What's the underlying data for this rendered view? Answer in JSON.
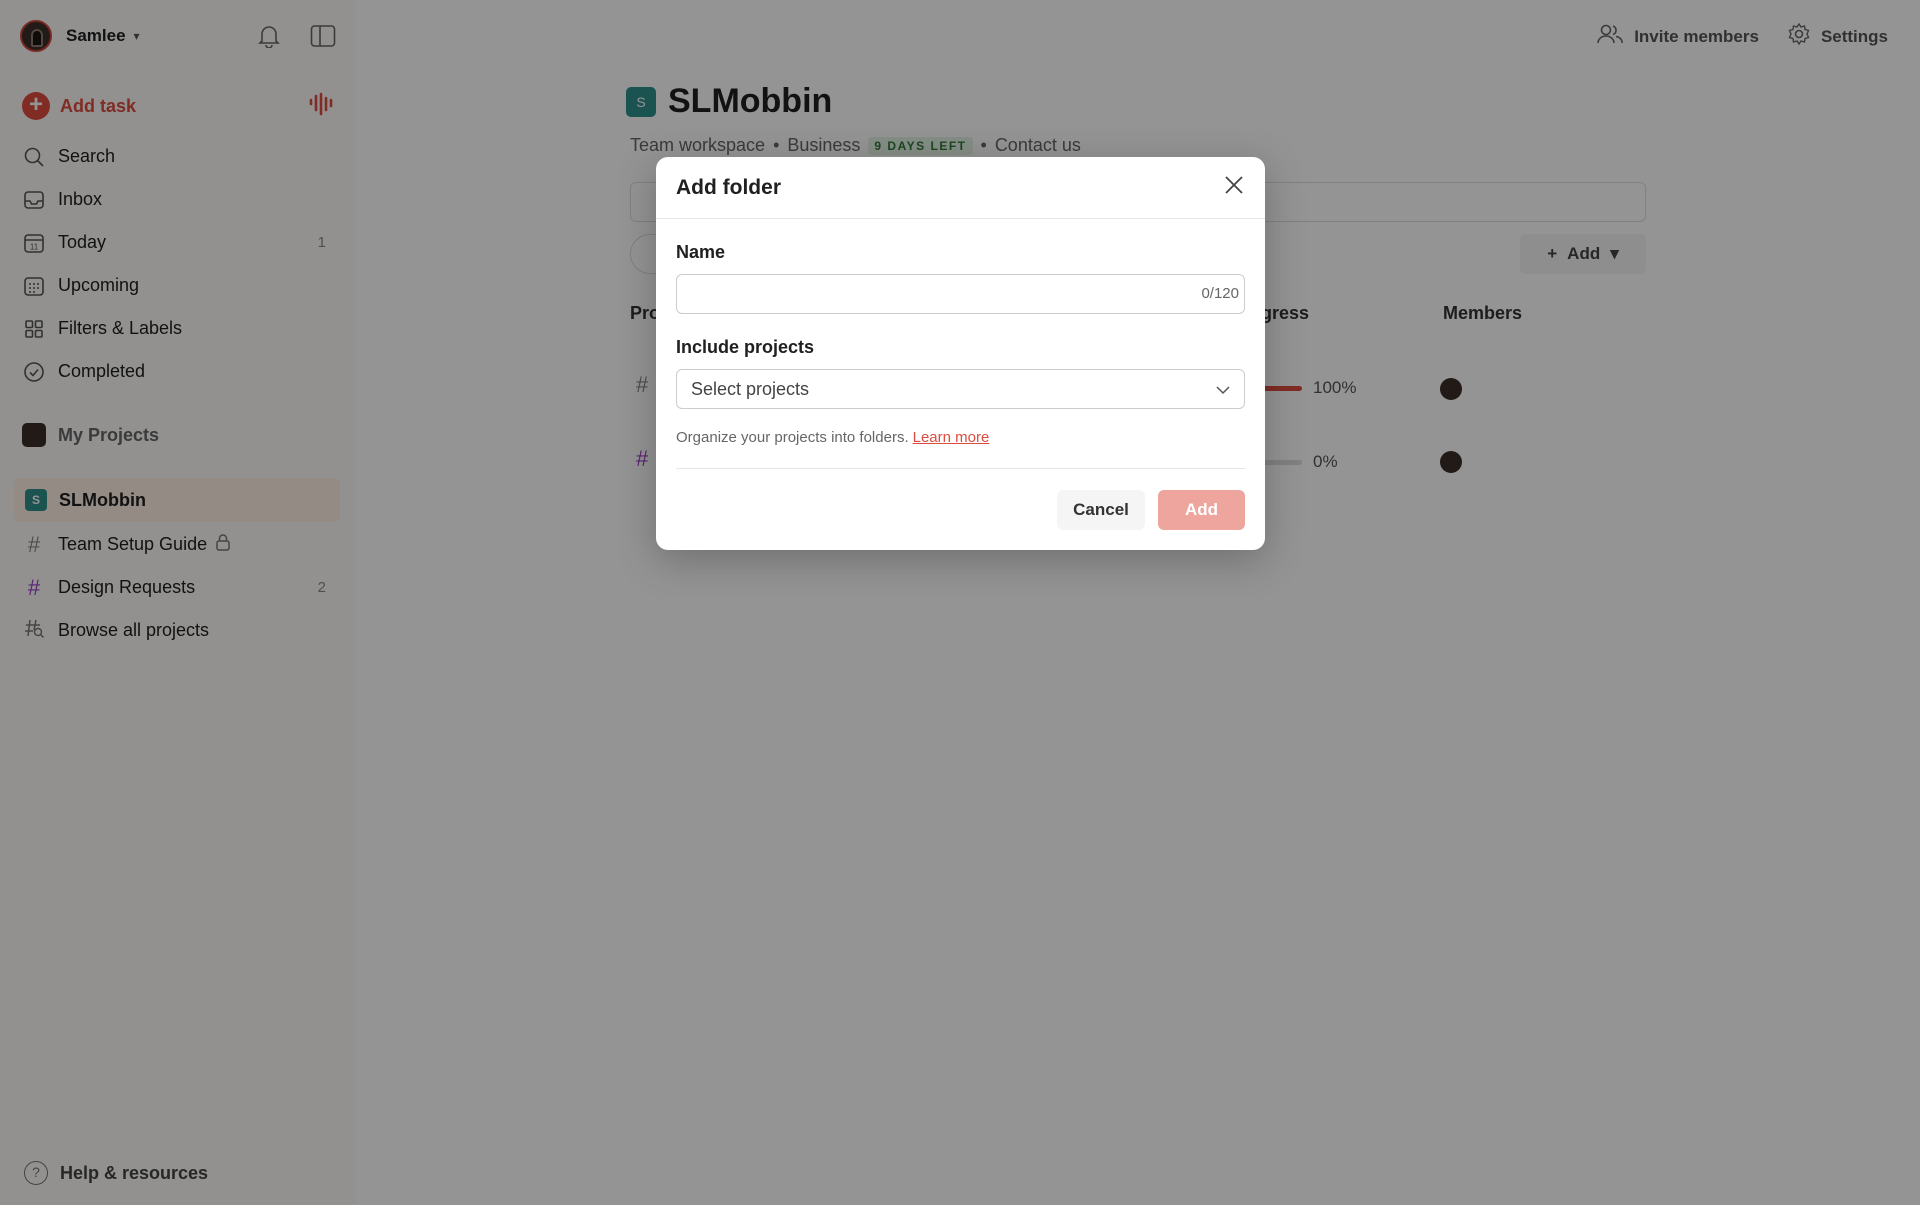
{
  "sidebar": {
    "user_name": "Samlee",
    "add_task_label": "Add task",
    "nav": [
      {
        "label": "Search",
        "icon": "search-icon",
        "count": ""
      },
      {
        "label": "Inbox",
        "icon": "inbox-icon",
        "count": ""
      },
      {
        "label": "Today",
        "icon": "calendar-today-icon",
        "count": "1"
      },
      {
        "label": "Upcoming",
        "icon": "calendar-grid-icon",
        "count": ""
      },
      {
        "label": "Filters & Labels",
        "icon": "grid-icon",
        "count": ""
      },
      {
        "label": "Completed",
        "icon": "check-circle-icon",
        "count": ""
      }
    ],
    "my_projects_label": "My Projects",
    "workspace": {
      "badge": "S",
      "name": "SLMobbin"
    },
    "projects": [
      {
        "label": "Team Setup Guide",
        "count": ""
      },
      {
        "label": "Design Requests",
        "count": "2"
      },
      {
        "label": "Browse all projects",
        "count": ""
      }
    ],
    "help_label": "Help & resources"
  },
  "topbar": {
    "invite_label": "Invite members",
    "settings_label": "Settings"
  },
  "main": {
    "badge": "S",
    "title": "SLMobbin",
    "meta_workspace": "Team workspace",
    "meta_plan": "Business",
    "meta_days_left": "9 DAYS LEFT",
    "meta_contact": "Contact us",
    "add_button_label": "Add",
    "col_project": "Pro",
    "col_progress": "ogress",
    "col_members": "Members",
    "rows": [
      {
        "progress_percent": 100,
        "progress_label": "100%"
      },
      {
        "progress_percent": 0,
        "progress_label": "0%"
      }
    ]
  },
  "modal": {
    "title": "Add folder",
    "name_label": "Name",
    "name_value": "",
    "name_counter": "0/120",
    "include_label": "Include projects",
    "select_placeholder": "Select projects",
    "hint_text": "Organize your projects into folders.",
    "learn_more": "Learn more",
    "cancel_label": "Cancel",
    "add_label": "Add"
  },
  "colors": {
    "accent": "#dc4c3e",
    "workspace_badge": "#2f8f8a",
    "days_left_bg": "#e5f4e7"
  }
}
